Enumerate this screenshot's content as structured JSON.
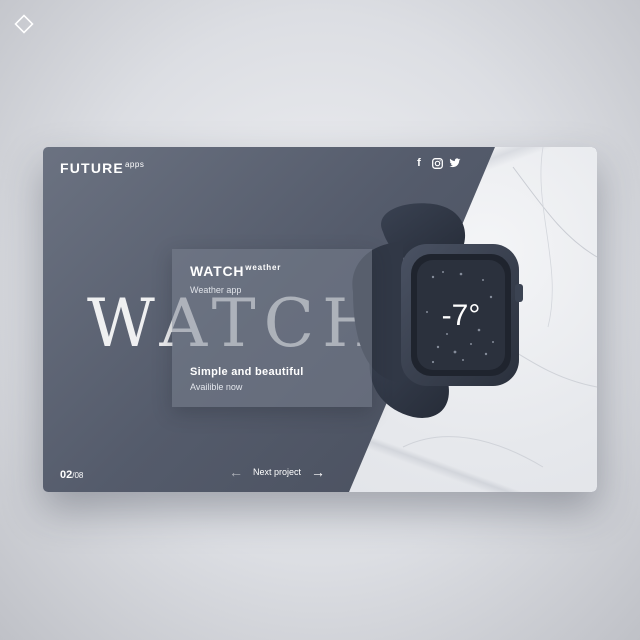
{
  "brand": {
    "name": "FUTURE",
    "suffix": "apps"
  },
  "socials": [
    {
      "icon": "facebook-icon",
      "glyph": "f"
    },
    {
      "icon": "instagram-icon",
      "glyph": "◘"
    },
    {
      "icon": "twitter-icon",
      "glyph": "🐦"
    }
  ],
  "hero": {
    "background_word": "WATCH"
  },
  "panel": {
    "title": "WATCH",
    "title_suffix": "weather",
    "subtitle": "Weather app",
    "tagline": "Simple and beautiful",
    "availability": "Availible now"
  },
  "watch_display": {
    "temperature": "-7°"
  },
  "pagination": {
    "current": "02",
    "total": "/08"
  },
  "navigation": {
    "next_label": "Next project",
    "prev_icon": "arrow-left-icon",
    "next_icon": "arrow-right-icon"
  },
  "colors": {
    "card": "#545b6b",
    "panel": "#78808e",
    "text": "#ffffff",
    "watch": "#2f3746"
  }
}
